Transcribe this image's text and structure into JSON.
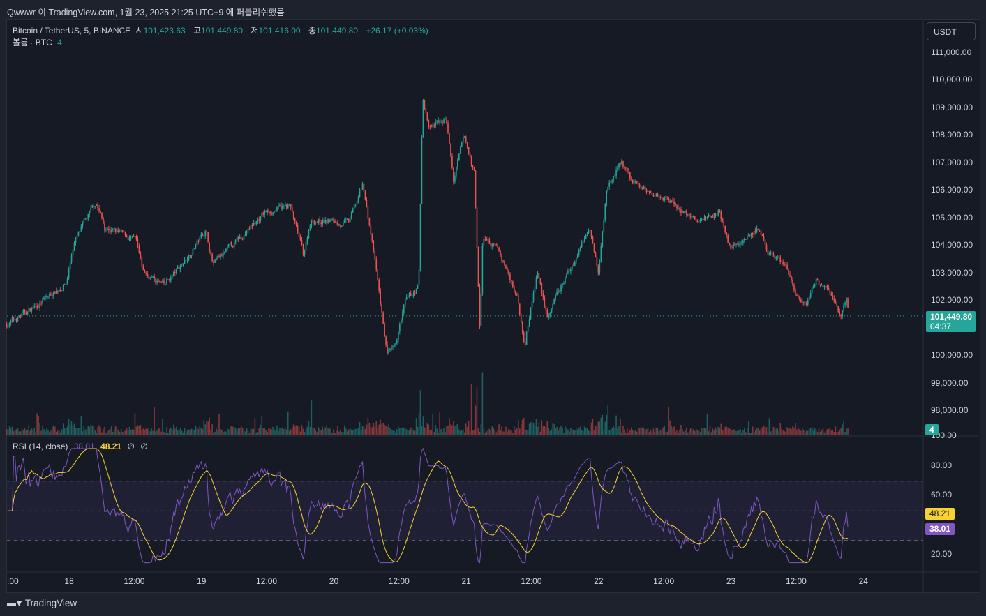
{
  "publish_line": "Qwwwr 이 TradingView.com, 1월 23, 2025 21:25 UTC+9 에 퍼블리쉬했음",
  "legend": {
    "symbol": "Bitcoin / TetherUS, 5, BINANCE",
    "open_label": "시",
    "open": "101,423.63",
    "high_label": "고",
    "high": "101,449.80",
    "low_label": "저",
    "low": "101,416.00",
    "close_label": "종",
    "close": "101,449.80",
    "change": "+26.17 (+0.03%)",
    "volume_label": "볼륨 · BTC",
    "volume": "4"
  },
  "rsi_legend": {
    "label": "RSI (14, close)",
    "rsi": "38.01",
    "ma": "48.21",
    "n1": "∅",
    "n2": "∅"
  },
  "currency_button": "USDT",
  "price_tag": {
    "price": "101,449.80",
    "countdown": "04:37"
  },
  "volume_tag": "4",
  "rsi_tags": {
    "ma": "48.21",
    "rsi": "38.01"
  },
  "brand": "TradingView",
  "colors": {
    "up": "#26a69a",
    "down": "#ef5350",
    "rsi": "#7e57c2",
    "rsi_ma": "#f7d230",
    "bg": "#161a25"
  },
  "chart_data": {
    "type": "candlestick",
    "price_axis": {
      "ticks": [
        "111,000.00",
        "110,000.00",
        "109,000.00",
        "108,000.00",
        "107,000.00",
        "106,000.00",
        "105,000.00",
        "104,000.00",
        "103,000.00",
        "102,000.00",
        "100,000.00",
        "99,000.00",
        "98,000.00"
      ],
      "values": [
        111000,
        110000,
        109000,
        108000,
        107000,
        106000,
        105000,
        104000,
        103000,
        102000,
        100000,
        99000,
        98000
      ],
      "last_price": 101449.8
    },
    "rsi_axis": {
      "ticks": [
        "100.00",
        "80.00",
        "60.00",
        "20.00"
      ],
      "values": [
        100,
        80,
        60,
        20
      ],
      "bands": [
        70,
        30
      ],
      "mid": 50
    },
    "time_axis": {
      "labels": [
        ":00",
        "18",
        "12:00",
        "19",
        "12:00",
        "20",
        "12:00",
        "21",
        "12:00",
        "22",
        "12:00",
        "23",
        "12:00",
        "24"
      ],
      "hours_from_jan18": [
        -10.2,
        0,
        12,
        24,
        36,
        48,
        60,
        72,
        84,
        96,
        108,
        120,
        132,
        144
      ]
    },
    "close_path_hours_price": [
      [
        -11.3,
        101140
      ],
      [
        -6.2,
        101780
      ],
      [
        -0.5,
        102660
      ],
      [
        0.8,
        104060
      ],
      [
        4.9,
        105580
      ],
      [
        6.4,
        104690
      ],
      [
        12.1,
        104180
      ],
      [
        13.4,
        103040
      ],
      [
        17.2,
        102540
      ],
      [
        20.4,
        103300
      ],
      [
        24.8,
        104560
      ],
      [
        26.1,
        103300
      ],
      [
        31.8,
        104440
      ],
      [
        35.5,
        105200
      ],
      [
        40.0,
        105450
      ],
      [
        42.5,
        103680
      ],
      [
        43.8,
        104940
      ],
      [
        50.7,
        104820
      ],
      [
        53.3,
        106210
      ],
      [
        55.2,
        103800
      ],
      [
        57.7,
        100000
      ],
      [
        59.0,
        100250
      ],
      [
        60.9,
        101900
      ],
      [
        63.4,
        102540
      ],
      [
        64.1,
        109380
      ],
      [
        65.3,
        108240
      ],
      [
        68.4,
        108620
      ],
      [
        69.7,
        106340
      ],
      [
        71.6,
        107980
      ],
      [
        73.5,
        106590
      ],
      [
        74.5,
        100760
      ],
      [
        75.0,
        104310
      ],
      [
        77.9,
        103800
      ],
      [
        81.1,
        102280
      ],
      [
        82.6,
        100500
      ],
      [
        84.9,
        103040
      ],
      [
        86.8,
        101400
      ],
      [
        88.7,
        102280
      ],
      [
        92.5,
        103800
      ],
      [
        94.4,
        104820
      ],
      [
        96.0,
        103040
      ],
      [
        97.5,
        106090
      ],
      [
        100.1,
        107050
      ],
      [
        102.0,
        106340
      ],
      [
        105.1,
        105960
      ],
      [
        108.9,
        105700
      ],
      [
        114.0,
        104820
      ],
      [
        117.8,
        105320
      ],
      [
        119.7,
        103930
      ],
      [
        121.6,
        104180
      ],
      [
        124.7,
        104560
      ],
      [
        126.6,
        103800
      ],
      [
        129.8,
        103300
      ],
      [
        131.7,
        102280
      ],
      [
        133.6,
        101650
      ],
      [
        135.5,
        102790
      ],
      [
        138.7,
        102030
      ],
      [
        140.0,
        101400
      ],
      [
        140.9,
        102080
      ],
      [
        141.4,
        101450
      ]
    ]
  }
}
